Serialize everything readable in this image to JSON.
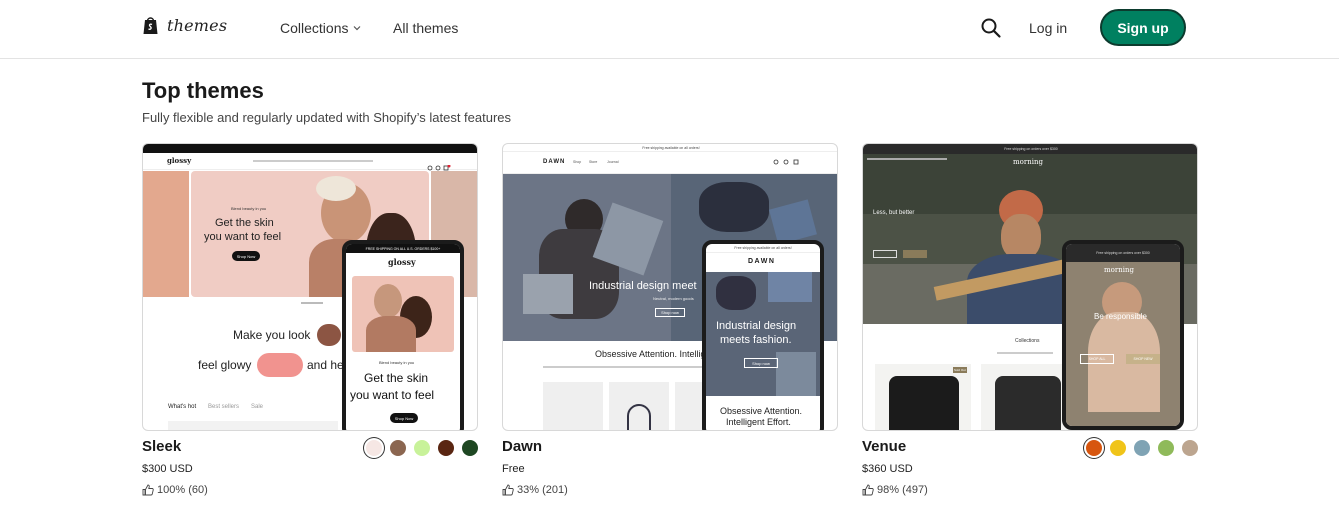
{
  "header": {
    "logo_text": "themes",
    "nav": [
      {
        "label": "Collections"
      },
      {
        "label": "All themes"
      }
    ],
    "login_label": "Log in",
    "signup_label": "Sign up",
    "signup_color": "#008060"
  },
  "section": {
    "title": "Top themes",
    "subtitle": "Fully flexible and regularly updated with Shopify’s latest features"
  },
  "themes": [
    {
      "name": "Sleek",
      "price": "$300 USD",
      "rating": "100% (60)",
      "swatches": [
        "#f6e7e4",
        "#8b6650",
        "#c8f29a",
        "#5a2612",
        "#1e4722"
      ],
      "selected_swatch": 0,
      "preview": {
        "brand": "glossy",
        "hero_kicker": "Blend beauty in you",
        "hero_text_1": "Get the skin",
        "hero_text_2": "you want to feel",
        "hero_button": "Shop Now",
        "body_text_1": "Make you look",
        "body_text_2": "feel glowy",
        "body_text_3": "and he",
        "tabs": [
          "What's hot",
          "Best sellers",
          "Sale"
        ],
        "phone_banner": "FREE SHIPPING ON ALL U.S. ORDERS $100+",
        "phone_brand": "glossy",
        "phone_kicker": "Blend beauty in you",
        "phone_text_1": "Get the skin",
        "phone_text_2": "you want to feel",
        "phone_button": "Shop Now"
      }
    },
    {
      "name": "Dawn",
      "price": "Free",
      "rating": "33% (201)",
      "preview": {
        "banner": "Free shipping available on all orders!",
        "brand": "DAWN",
        "nav": [
          "Shop",
          "Store",
          "Journal"
        ],
        "hero_text": "Industrial design meet",
        "hero_sub": "Neutral, modern goods",
        "hero_button": "Shop now",
        "body_text": "Obsessive Attention. Intelligi",
        "phone_banner": "Free shipping available on all orders!",
        "phone_brand": "DAWN",
        "phone_hero_1": "Industrial design",
        "phone_hero_2": "meets fashion.",
        "phone_button": "Shop now",
        "phone_body_1": "Obsessive Attention.",
        "phone_body_2": "Intelligent Effort."
      }
    },
    {
      "name": "Venue",
      "price": "$360 USD",
      "rating": "98% (497)",
      "swatches": [
        "#d7560f",
        "#f0c419",
        "#7fa3b4",
        "#8fba5a",
        "#bca58f"
      ],
      "selected_swatch": 0,
      "preview": {
        "banner": "Free shipping on orders over $300",
        "brand": "morning",
        "hero_text": "Less, but better",
        "section": "Collections",
        "badge": "Sold Out",
        "phone_banner": "Free shipping on orders over $300",
        "phone_brand": "morning",
        "phone_hero": "Be responsible",
        "phone_btn_1": "SHOP ALL",
        "phone_btn_2": "SHOP NEW"
      }
    }
  ]
}
